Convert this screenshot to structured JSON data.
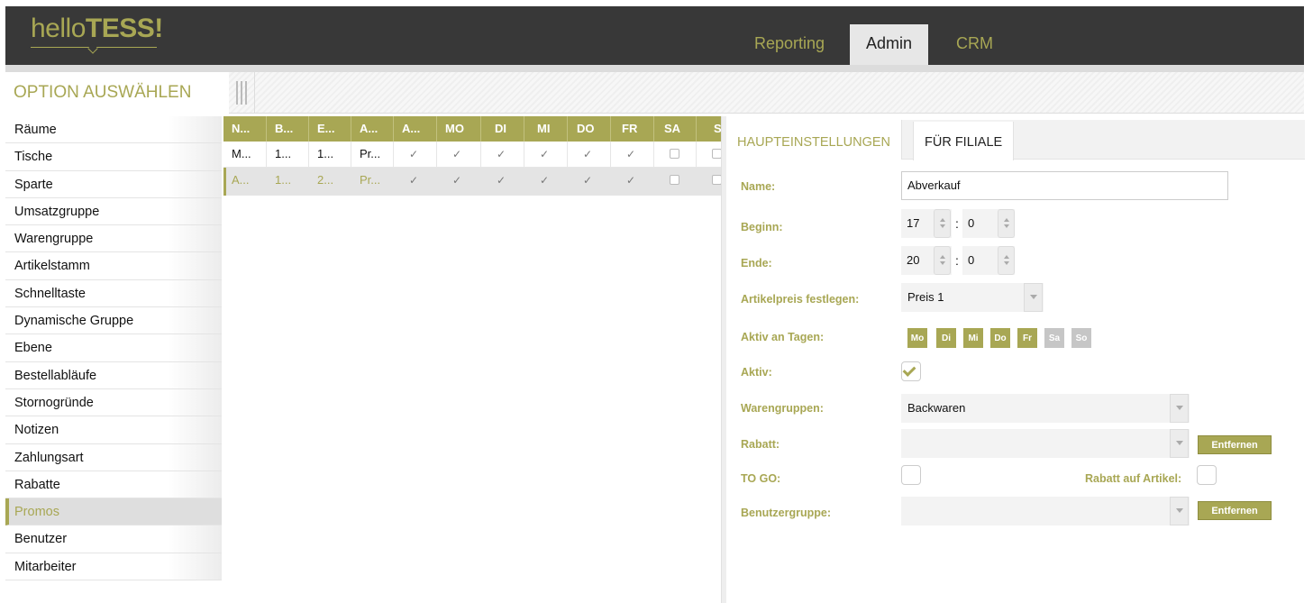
{
  "header": {
    "logo_light": "hello",
    "logo_bold": "TESS!",
    "tabs": [
      {
        "label": "Reporting",
        "active": false
      },
      {
        "label": "Admin",
        "active": true
      },
      {
        "label": "CRM",
        "active": false
      }
    ]
  },
  "option_bar": {
    "title": "OPTION AUSWÄHLEN"
  },
  "sidebar": {
    "items": [
      {
        "label": "Räume"
      },
      {
        "label": "Tische"
      },
      {
        "label": "Sparte"
      },
      {
        "label": "Umsatzgruppe"
      },
      {
        "label": "Warengruppe"
      },
      {
        "label": "Artikelstamm"
      },
      {
        "label": "Schnelltaste"
      },
      {
        "label": "Dynamische Gruppe"
      },
      {
        "label": "Ebene"
      },
      {
        "label": "Bestellabläufe"
      },
      {
        "label": "Stornogründe"
      },
      {
        "label": "Notizen"
      },
      {
        "label": "Zahlungsart"
      },
      {
        "label": "Rabatte"
      },
      {
        "label": "Promos",
        "active": true
      },
      {
        "label": "Benutzer"
      },
      {
        "label": "Mitarbeiter"
      }
    ]
  },
  "grid": {
    "headers": [
      "N...",
      "B...",
      "E...",
      "A...",
      "A...",
      "MO",
      "DI",
      "MI",
      "DO",
      "FR",
      "SA",
      "S"
    ],
    "rows": [
      {
        "text": [
          "M...",
          "1...",
          "1...",
          "Pr..."
        ],
        "checks": [
          true,
          true,
          true,
          true,
          true,
          true,
          false,
          false
        ]
      },
      {
        "text": [
          "A...",
          "1...",
          "2...",
          "Pr..."
        ],
        "checks": [
          true,
          true,
          true,
          true,
          true,
          true,
          false,
          false
        ],
        "selected": true
      }
    ]
  },
  "panel": {
    "tabs": {
      "main": "HAUPTEINSTELLUNGEN",
      "branch": "FÜR FILIALE"
    },
    "labels": {
      "name": "Name:",
      "begin": "Beginn:",
      "end": "Ende:",
      "price": "Artikelpreis festlegen:",
      "days": "Aktiv an Tagen:",
      "active": "Aktiv:",
      "product_groups": "Warengruppen:",
      "discount": "Rabatt:",
      "to_go": "TO GO:",
      "discount_on_article": "Rabatt auf Artikel:",
      "user_group": "Benutzergruppe:"
    },
    "values": {
      "name": "Abverkauf",
      "begin_hour": "17",
      "begin_min": "0",
      "end_hour": "20",
      "end_min": "0",
      "price": "Preis 1",
      "product_groups": "Backwaren",
      "discount": "",
      "user_group": ""
    },
    "days": [
      {
        "label": "Mo",
        "on": true
      },
      {
        "label": "Di",
        "on": true
      },
      {
        "label": "Mi",
        "on": true
      },
      {
        "label": "Do",
        "on": true
      },
      {
        "label": "Fr",
        "on": true
      },
      {
        "label": "Sa",
        "on": false
      },
      {
        "label": "So",
        "on": false
      }
    ],
    "active_checked": true,
    "to_go_checked": false,
    "discount_on_article_checked": false,
    "remove_label": "Entfernen"
  },
  "colors": {
    "accent": "#a8a754",
    "header_bg": "#383838"
  }
}
